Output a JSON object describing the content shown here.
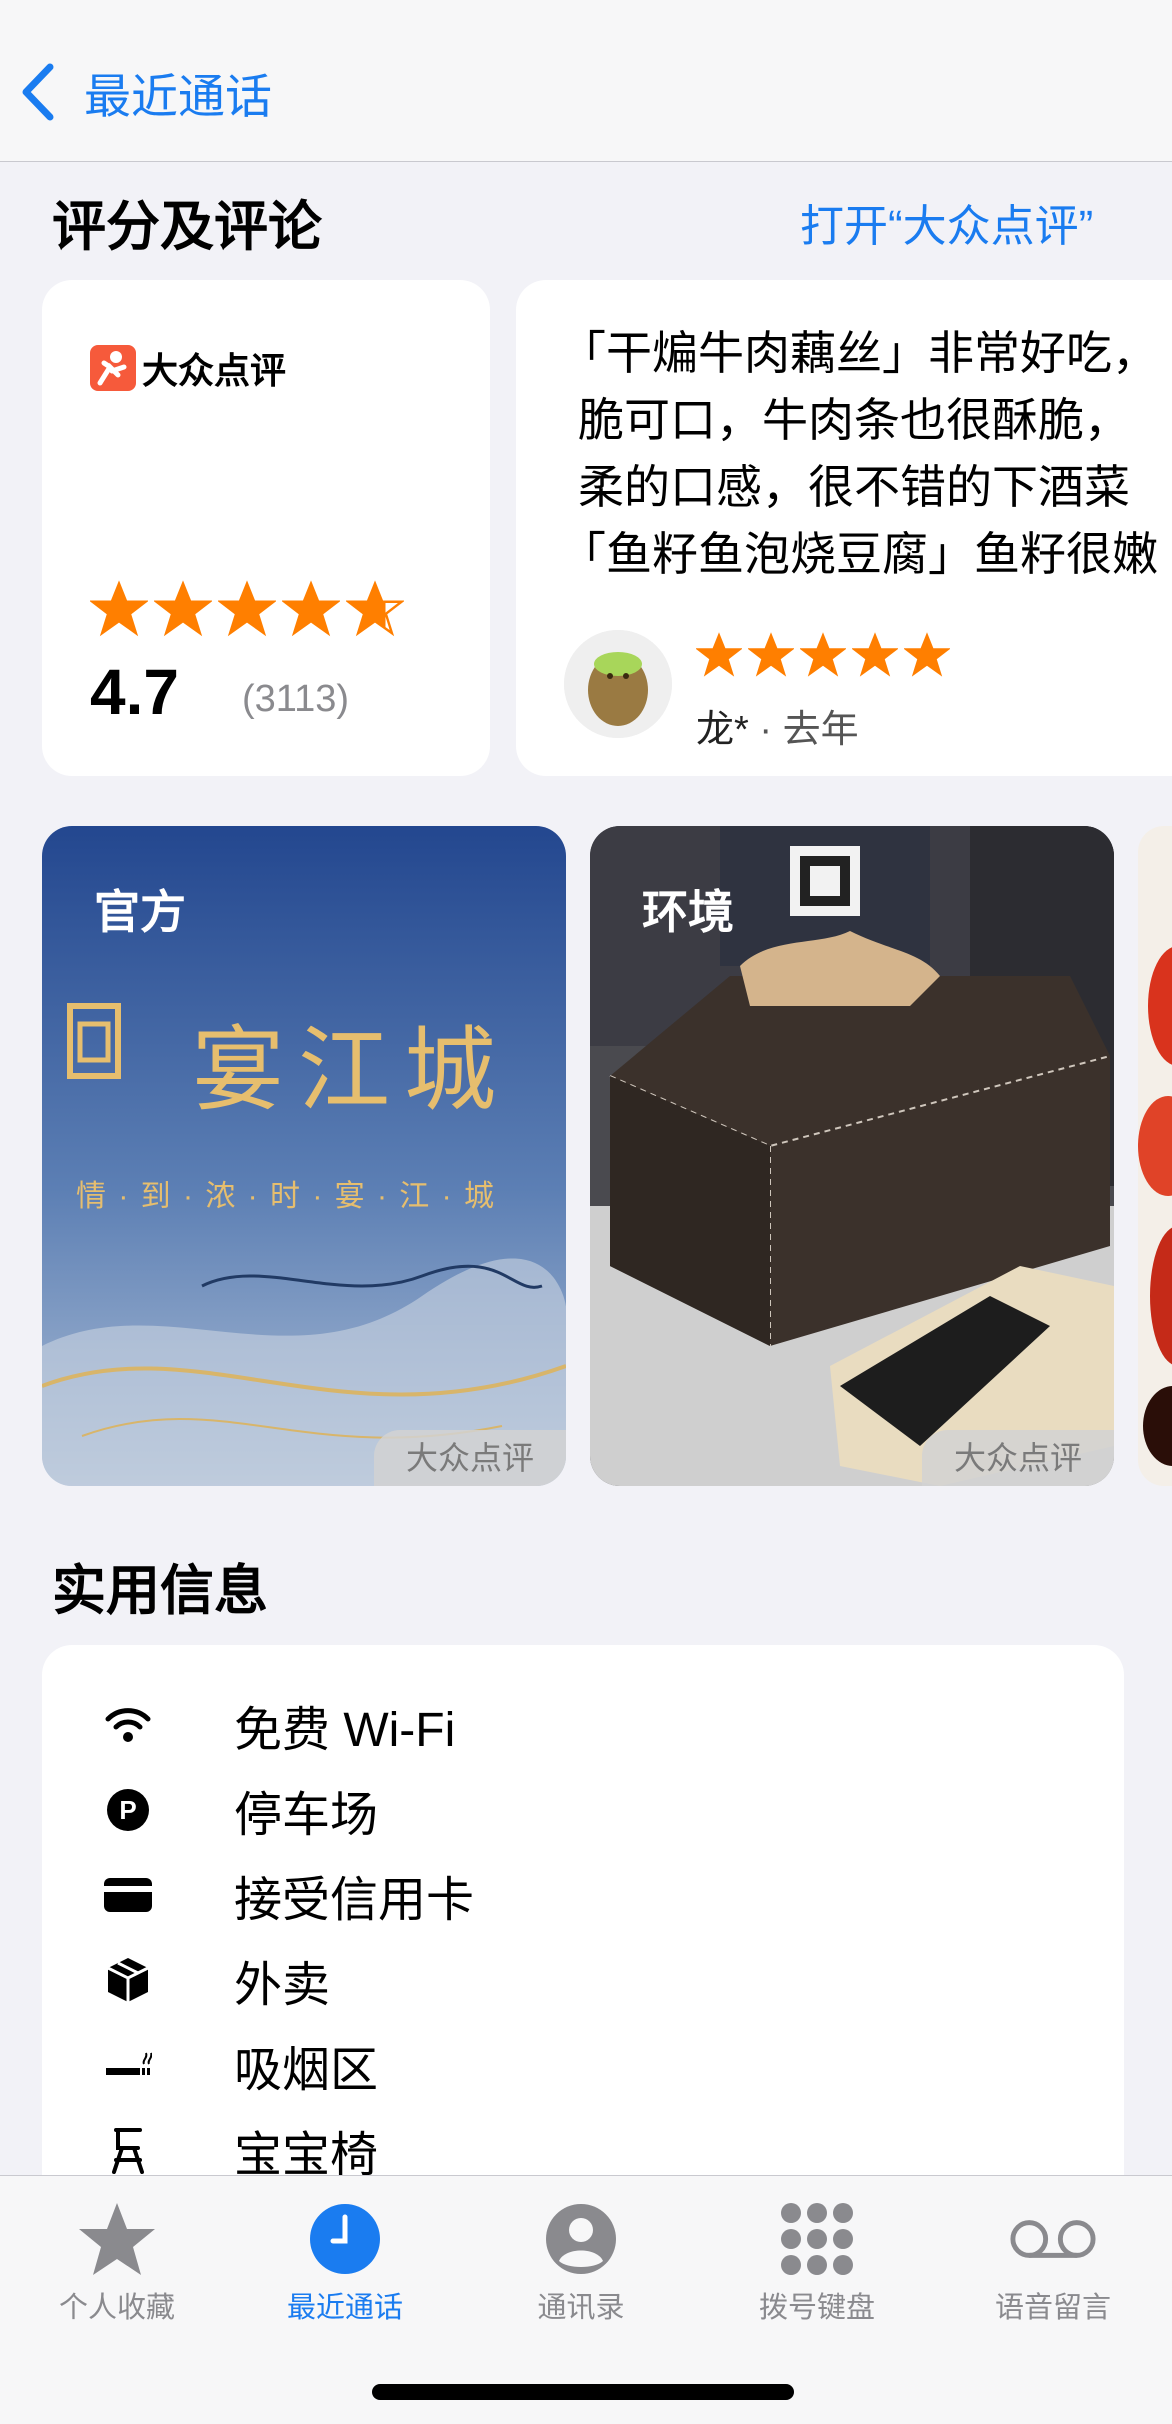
{
  "nav": {
    "back_label": "最近通话"
  },
  "ratings_section": {
    "title": "评分及评论",
    "open_link": "打开“大众点评”"
  },
  "rating_card": {
    "brand": "大众点评",
    "rating": "4.7",
    "rating_value": 4.7,
    "count": "(3113)"
  },
  "review_card": {
    "lines": [
      "「干煸牛肉藕丝」非常好吃，",
      "脆可口，牛肉条也很酥脆，",
      "柔的口感，很不错的下酒菜",
      "「鱼籽鱼泡烧豆腐」鱼籽很嫩"
    ],
    "reviewer_name": "龙*",
    "reviewer_time": "· 去年",
    "stars": 5
  },
  "photos": [
    {
      "tag": "官方",
      "source": "大众点评",
      "sign_title": "宴江城",
      "sign_slogan": "情 · 到 · 浓 · 时 · 宴 · 江 · 城"
    },
    {
      "tag": "环境",
      "source": "大众点评"
    }
  ],
  "info_section": {
    "title": "实用信息",
    "items": [
      {
        "label": "免费 Wi-Fi",
        "icon": "wifi-icon"
      },
      {
        "label": "停车场",
        "icon": "parking-icon"
      },
      {
        "label": "接受信用卡",
        "icon": "credit-card-icon"
      },
      {
        "label": "外卖",
        "icon": "package-icon"
      },
      {
        "label": "吸烟区",
        "icon": "smoking-icon"
      },
      {
        "label": "宝宝椅",
        "icon": "high-chair-icon"
      }
    ]
  },
  "tabbar": {
    "tabs": [
      {
        "label": "个人收藏",
        "icon": "star-icon"
      },
      {
        "label": "最近通话",
        "icon": "clock-icon",
        "active": true
      },
      {
        "label": "通讯录",
        "icon": "person-icon"
      },
      {
        "label": "拨号键盘",
        "icon": "keypad-icon"
      },
      {
        "label": "语音留言",
        "icon": "voicemail-icon"
      }
    ]
  },
  "colors": {
    "accent": "#1a7cf0",
    "star": "#ff7f00",
    "brand": "#f65a3b"
  }
}
